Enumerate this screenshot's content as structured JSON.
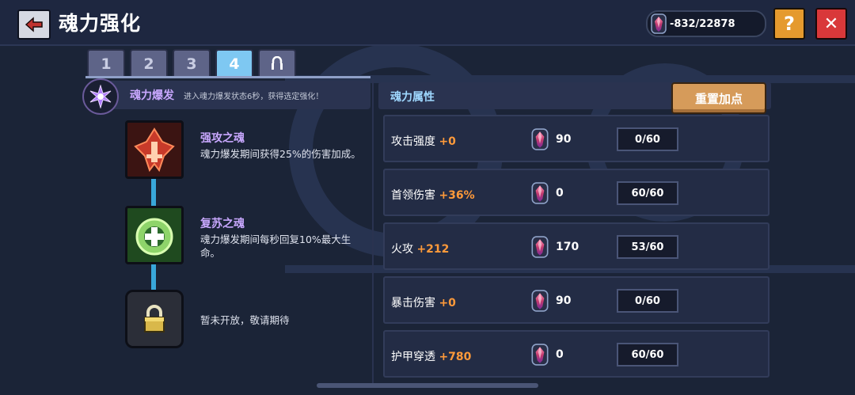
{
  "header": {
    "title": "魂力强化",
    "currency_value": "-832/22878",
    "help_label": "?",
    "close_label": "✕"
  },
  "tabs": [
    "1",
    "2",
    "3",
    "4"
  ],
  "active_tab": "4",
  "burst": {
    "name": "魂力爆发",
    "description": "进入魂力爆发状态6秒，获得选定强化！"
  },
  "skills": [
    {
      "name": "强攻之魂",
      "description": "魂力爆发期间获得25%的伤害加成。",
      "icon": "attack-soul-icon"
    },
    {
      "name": "复苏之魂",
      "description": "魂力爆发期间每秒回复10%最大生命。",
      "icon": "revive-soul-icon"
    },
    {
      "name": "",
      "description": "暂未开放，敬请期待",
      "icon": "lock-icon"
    }
  ],
  "attributes_panel": {
    "title": "魂力属性",
    "reset_label": "重置加点"
  },
  "attributes": [
    {
      "name": "攻击强度",
      "bonus": "+0",
      "cost": "90",
      "level": "0/60"
    },
    {
      "name": "首领伤害",
      "bonus": "+36%",
      "cost": "0",
      "level": "60/60"
    },
    {
      "name": "火攻",
      "bonus": "+212",
      "cost": "170",
      "level": "53/60"
    },
    {
      "name": "暴击伤害",
      "bonus": "+0",
      "cost": "90",
      "level": "0/60"
    },
    {
      "name": "护甲穿透",
      "bonus": "+780",
      "cost": "0",
      "level": "60/60"
    }
  ],
  "colors": {
    "accent_bonus": "#ff9a3a",
    "active_tab": "#7ec8f2",
    "reset_button": "#d69b5a",
    "close_button": "#d9383a",
    "help_button": "#e59a2e"
  }
}
